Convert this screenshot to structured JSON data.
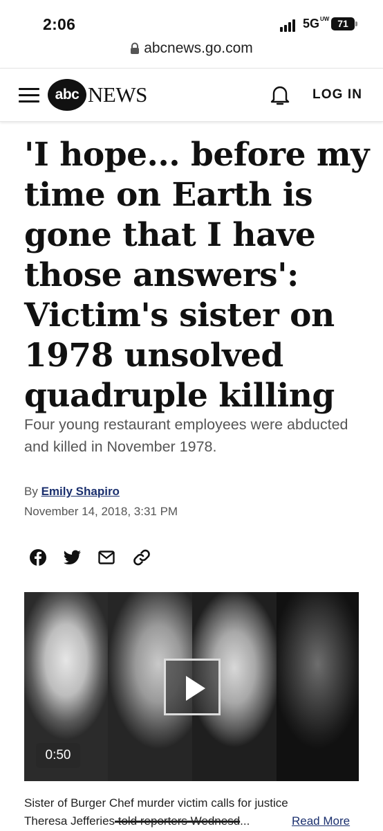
{
  "status_bar": {
    "time": "2:06",
    "network": "5G",
    "network_sup": "UW",
    "battery": "71"
  },
  "url_bar": {
    "url": "abcnews.go.com",
    "icon": "lock-icon"
  },
  "header": {
    "logo_abc": "abc",
    "logo_news": "NEWS",
    "login_label": "LOG IN",
    "icons": [
      "menu-icon",
      "bell-icon"
    ]
  },
  "article": {
    "headline": "'I hope... before my time on Earth is gone that I have those answers': Victim's sister on 1978 unsolved quadruple killing",
    "subhead": "Four young restaurant employees were abducted and killed in November 1978.",
    "byline_prefix": "By",
    "author": "Emily Shapiro",
    "date": "November 14, 2018, 3:31 PM",
    "share_icons": [
      "facebook-icon",
      "twitter-icon",
      "email-icon",
      "link-icon"
    ]
  },
  "video": {
    "duration": "0:50",
    "caption_title": "Sister of Burger Chef murder victim calls for justice",
    "caption_start": "Theresa Jefferies",
    "caption_struck": " told reporters Wednesd",
    "caption_end": "...",
    "read_more": "Read More"
  }
}
